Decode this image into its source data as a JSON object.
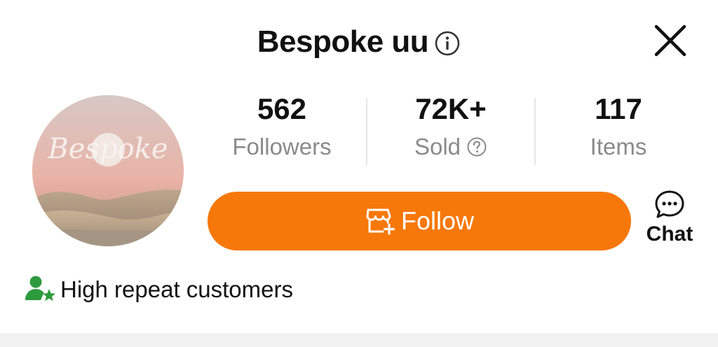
{
  "shop": {
    "name": "Bespoke uu",
    "avatar_text": "Bespoke"
  },
  "stats": [
    {
      "value": "562",
      "label": "Followers"
    },
    {
      "value": "72K+",
      "label": "Sold"
    },
    {
      "value": "117",
      "label": "Items"
    }
  ],
  "actions": {
    "follow_label": "Follow",
    "chat_label": "Chat"
  },
  "badge": {
    "text": "High repeat customers",
    "icon": "user-star-icon",
    "color": "#2e9a3e"
  },
  "colors": {
    "accent": "#f7780a",
    "text": "#111111",
    "muted": "#8a8a8a"
  }
}
